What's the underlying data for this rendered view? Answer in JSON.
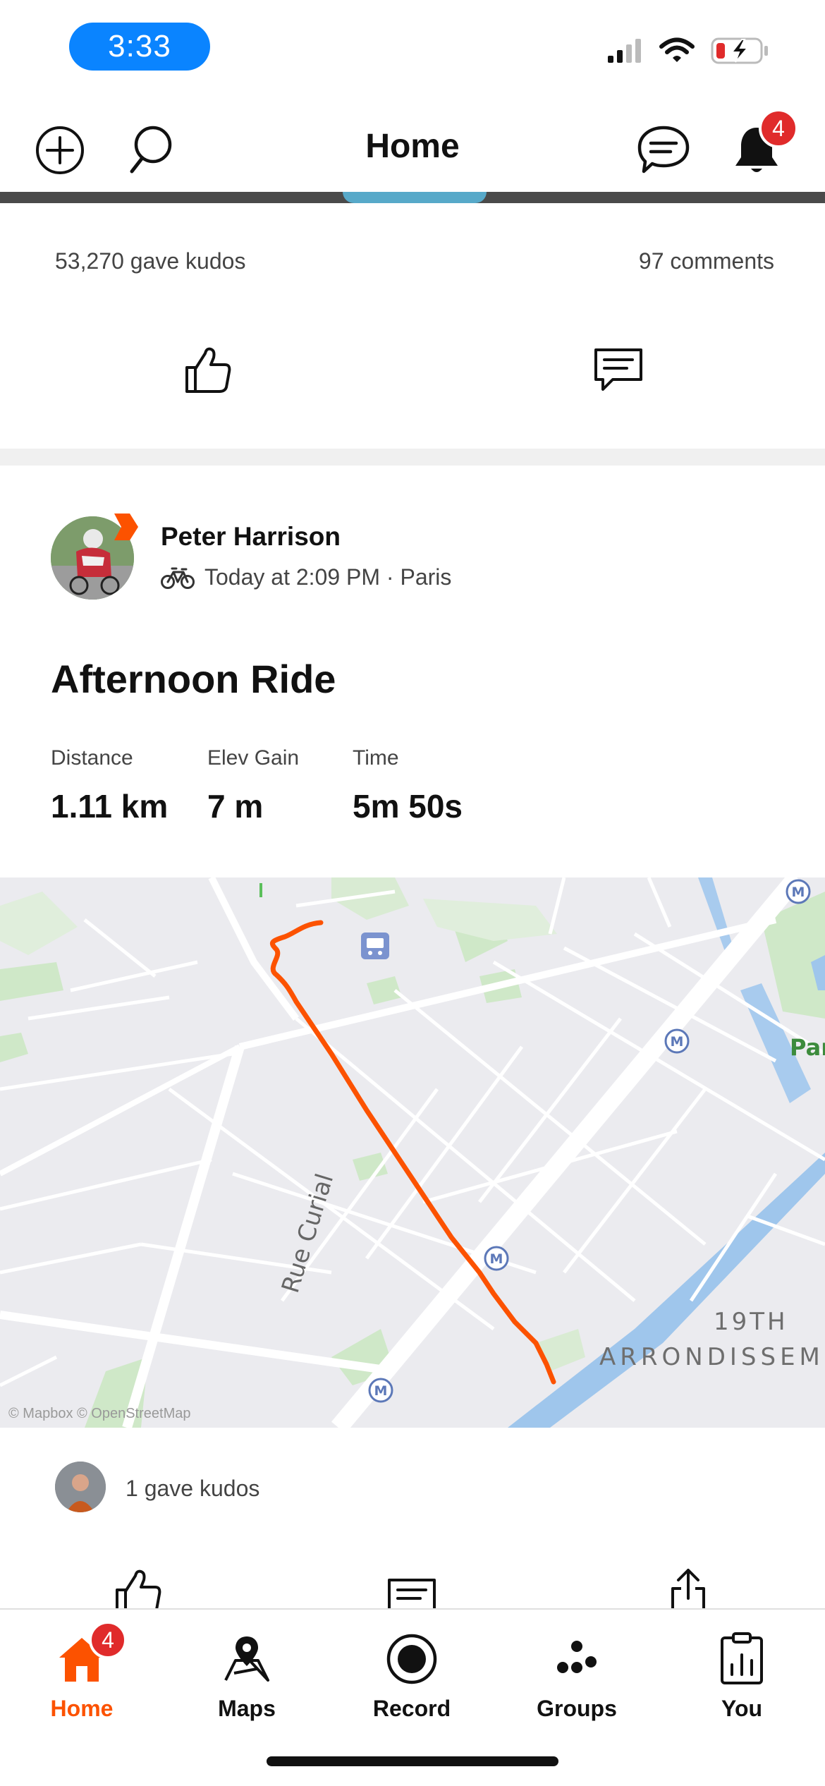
{
  "status_bar": {
    "time": "3:33"
  },
  "header": {
    "title": "Home",
    "notification_count": "4"
  },
  "post_top": {
    "kudos_text": "53,270 gave kudos",
    "comments_text": "97 comments"
  },
  "activity": {
    "athlete_name": "Peter Harrison",
    "meta": "Today at 2:09 PM · Paris",
    "title": "Afternoon Ride",
    "stats": [
      {
        "label": "Distance",
        "value": "1.11 km"
      },
      {
        "label": "Elev Gain",
        "value": "7 m"
      },
      {
        "label": "Time",
        "value": "5m 50s"
      }
    ],
    "map": {
      "street_label": "Rue Curial",
      "district_line1": "19TH",
      "district_line2": "ARRONDISSEM",
      "park_label": "Par",
      "credit": "© Mapbox © OpenStreetMap",
      "route_color": "#fc5200"
    },
    "kudos_text": "1 gave kudos"
  },
  "tabs": [
    {
      "label": "Home",
      "active": true,
      "badge": "4"
    },
    {
      "label": "Maps"
    },
    {
      "label": "Record"
    },
    {
      "label": "Groups"
    },
    {
      "label": "You"
    }
  ],
  "colors": {
    "accent": "#fc5200",
    "badge": "#e02b2b",
    "status_pill": "#0a84ff"
  }
}
